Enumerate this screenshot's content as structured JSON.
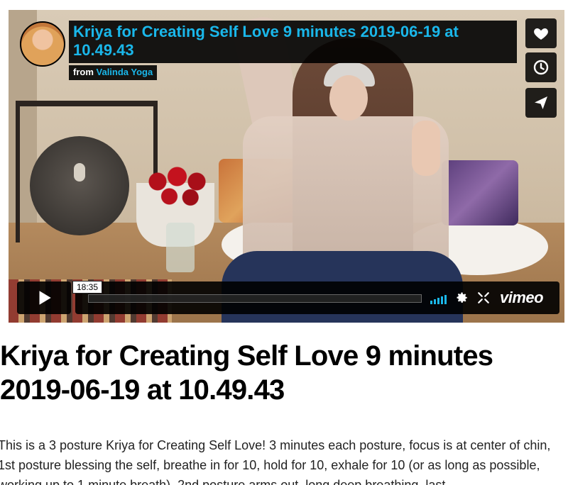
{
  "video": {
    "title": "Kriya for Creating Self Love 9 minutes 2019-06-19 at 10.49.43",
    "from_label": "from",
    "author": "Valinda Yoga",
    "time": "18:35",
    "brand": "vimeo"
  },
  "side_buttons": [
    {
      "icon": "heart-icon",
      "label": "Like"
    },
    {
      "icon": "clock-icon",
      "label": "Watch Later"
    },
    {
      "icon": "send-icon",
      "label": "Share"
    }
  ],
  "page": {
    "title": "Kriya for Creating Self Love 9 minutes\n2019-06-19 at 10.49.43",
    "description": "This is a 3 posture Kriya for Creating Self Love! 3 minutes each posture, focus is at center of chin, 1st posture blessing the self, breathe in for 10, hold for 10, exhale for 10 (or as long as possible, working up to 1 minute breath). 2nd posture arms out, long deep breathing, last"
  },
  "colors": {
    "accent": "#1ab7ea",
    "overlay": "#000000"
  }
}
